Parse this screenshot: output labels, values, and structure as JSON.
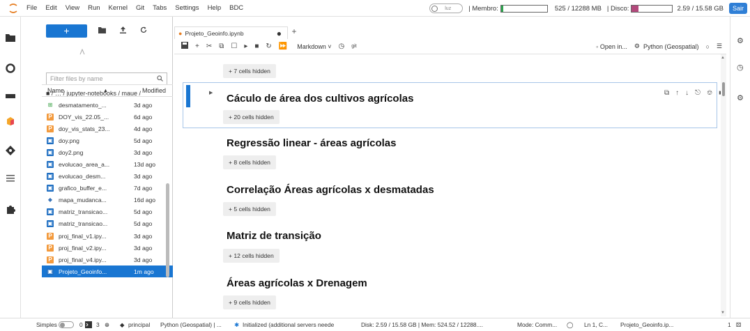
{
  "menubar": {
    "items": [
      "File",
      "Edit",
      "View",
      "Run",
      "Kernel",
      "Git",
      "Tabs",
      "Settings",
      "Help",
      "BDC"
    ],
    "toggle_label": "luz",
    "memory_label": "| Membro:",
    "memory_value": "525 / 12288 MB",
    "memory_fraction": 0.043,
    "disk_label": "| Disco:",
    "disk_value": "2.59 / 15.58 GB",
    "disk_fraction": 0.166,
    "exit_button": "Sair",
    "colors": {
      "memory_fill": "#2ea44f",
      "disk_fill": "#b3497c",
      "accent": "#1976d2"
    }
  },
  "filebrowser": {
    "new_button": "+",
    "filter_placeholder": "Filter files by name",
    "breadcrumb": "■ / … / jupyter-notebooks / maue /",
    "columns": {
      "name": "Name",
      "modified": "Modified"
    },
    "files": [
      {
        "name": "desmatamento_...",
        "modified": "3d ago",
        "icon": "csv-icon"
      },
      {
        "name": "DOY_vis_22.05_...",
        "modified": "6d ago",
        "icon": "pdf-icon"
      },
      {
        "name": "doy_vis_stats_23...",
        "modified": "4d ago",
        "icon": "pdf-icon"
      },
      {
        "name": "doy.png",
        "modified": "5d ago",
        "icon": "image-icon"
      },
      {
        "name": "doy2.png",
        "modified": "3d ago",
        "icon": "image-icon"
      },
      {
        "name": "evolucao_area_a...",
        "modified": "13d ago",
        "icon": "image-icon"
      },
      {
        "name": "evolucao_desm...",
        "modified": "3d ago",
        "icon": "image-icon"
      },
      {
        "name": "grafico_buffer_e...",
        "modified": "7d ago",
        "icon": "image-icon"
      },
      {
        "name": "mapa_mudanca...",
        "modified": "16d ago",
        "icon": "python-icon"
      },
      {
        "name": "matriz_transicao...",
        "modified": "5d ago",
        "icon": "image-icon"
      },
      {
        "name": "matriz_transicao...",
        "modified": "5d ago",
        "icon": "image-icon"
      },
      {
        "name": "proj_final_v1.ipy...",
        "modified": "3d ago",
        "icon": "pdf-icon"
      },
      {
        "name": "proj_final_v2.ipy...",
        "modified": "3d ago",
        "icon": "pdf-icon"
      },
      {
        "name": "proj_final_v4.ipy...",
        "modified": "3d ago",
        "icon": "pdf-icon"
      },
      {
        "name": "Projeto_Geoinfo...",
        "modified": "1m ago",
        "icon": "notebook-icon",
        "selected": true
      }
    ]
  },
  "notebook": {
    "tab_title": "Projeto_Geoinfo.ipynb",
    "cell_type": "Markdown ˅",
    "open_in": "◦ Open in...",
    "kernel": "Python (Geospatial)",
    "sections": [
      {
        "hidden": "+ 7 cells hidden"
      },
      {
        "title": "Cáculo de área dos cultivos agrícolas",
        "hidden": "+ 20 cells hidden"
      },
      {
        "title": "Regressão linear - áreas agrícolas",
        "hidden": "+ 8 cells hidden"
      },
      {
        "title": "Correlação Áreas agrícolas x desmatadas",
        "hidden": "+ 5 cells hidden"
      },
      {
        "title": "Matriz de transição",
        "hidden": "+ 12 cells hidden"
      },
      {
        "title": "Áreas agrícolas x Drenagem",
        "hidden": "+ 9 cells hidden"
      }
    ]
  },
  "statusbar": {
    "mode_toggle": "Simples",
    "kernels": "0",
    "terminals": "3",
    "git_branch": "principal",
    "kernel_status": "Python (Geospatial) | ...",
    "lsp": "Initialized (additional servers neede",
    "disk": "Disk: 2.59 / 15.58 GB | Mem: 524.52 / 12288....",
    "mode": "Mode: Comm...",
    "position": "Ln 1, C...",
    "file": "Projeto_Geoinfo.ip...",
    "notifications": "1"
  }
}
